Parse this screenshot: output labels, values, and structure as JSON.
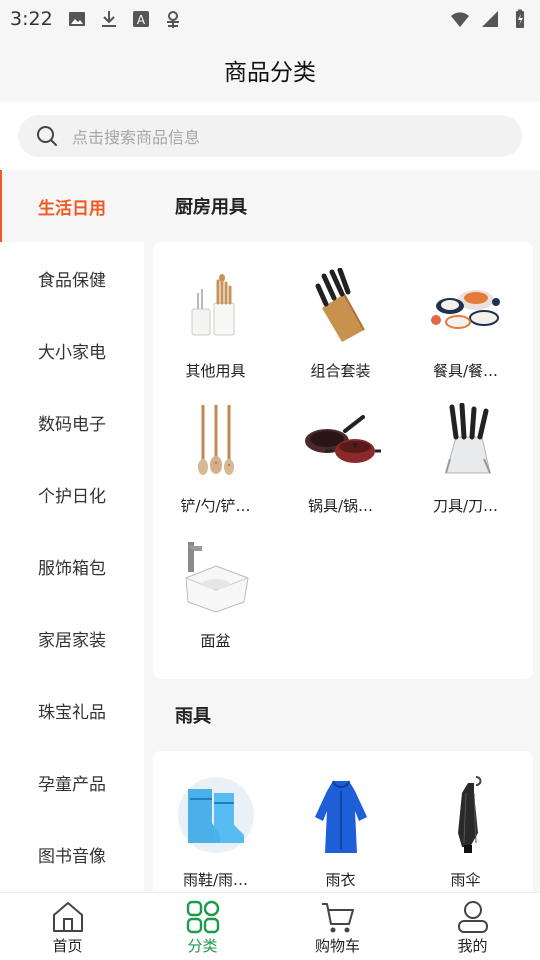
{
  "status_bar": {
    "time": "3:22",
    "left_icons": [
      "image-icon",
      "download-icon",
      "font-icon",
      "bug-icon"
    ],
    "right_icons": [
      "wifi-icon",
      "signal-icon",
      "battery-charging-icon"
    ]
  },
  "header": {
    "title": "商品分类"
  },
  "search": {
    "placeholder": "点击搜索商品信息",
    "icon": "search-icon"
  },
  "sidebar": {
    "items": [
      {
        "label": "生活日用",
        "active": true
      },
      {
        "label": "食品保健"
      },
      {
        "label": "大小家电"
      },
      {
        "label": "数码电子"
      },
      {
        "label": "个护日化"
      },
      {
        "label": "服饰箱包"
      },
      {
        "label": "家居家装"
      },
      {
        "label": "珠宝礼品"
      },
      {
        "label": "孕童产品"
      },
      {
        "label": "图书音像"
      }
    ]
  },
  "sections": [
    {
      "title": "厨房用具",
      "items": [
        {
          "label": "其他用具",
          "icon": "utensil-holder-icon"
        },
        {
          "label": "组合套装",
          "icon": "knife-block-icon"
        },
        {
          "label": "餐具/餐…",
          "icon": "tableware-set-icon"
        },
        {
          "label": "铲/勺/铲…",
          "icon": "ladles-icon"
        },
        {
          "label": "锅具/锅…",
          "icon": "pans-icon"
        },
        {
          "label": "刀具/刀…",
          "icon": "knife-stand-icon"
        },
        {
          "label": "面盆",
          "icon": "basin-icon"
        }
      ]
    },
    {
      "title": "雨具",
      "items": [
        {
          "label": "雨鞋/雨…",
          "icon": "shoe-cover-icon"
        },
        {
          "label": "雨衣",
          "icon": "raincoat-icon"
        },
        {
          "label": "雨伞",
          "icon": "umbrella-icon"
        }
      ]
    }
  ],
  "tabbar": {
    "items": [
      {
        "label": "首页",
        "icon": "home-icon"
      },
      {
        "label": "分类",
        "icon": "category-icon",
        "active": true
      },
      {
        "label": "购物车",
        "icon": "cart-icon"
      },
      {
        "label": "我的",
        "icon": "user-icon"
      }
    ]
  },
  "colors": {
    "accent": "#f05a22",
    "tab_active": "#1a9a4b"
  }
}
